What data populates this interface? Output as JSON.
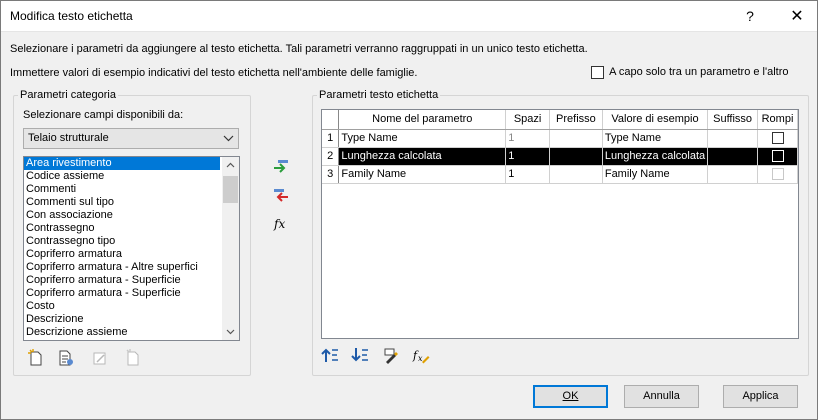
{
  "window": {
    "title": "Modifica testo etichetta",
    "help": "?",
    "close": "✕"
  },
  "intro": {
    "line1": "Selezionare i parametri da aggiungere al testo etichetta. Tali parametri verranno raggruppati in un unico testo etichetta.",
    "line2": "Immettere valori di esempio indicativi del testo etichetta nell'ambiente delle famiglie."
  },
  "wrap_checkbox": {
    "label": "A capo solo tra un parametro e l'altro",
    "checked": false
  },
  "category_group": {
    "label": "Parametri categoria",
    "select_label": "Selezionare campi disponibili da:",
    "combo_value": "Telaio strutturale",
    "items": [
      "Area rivestimento",
      "Codice assieme",
      "Commenti",
      "Commenti sul tipo",
      "Con associazione",
      "Contrassegno",
      "Contrassegno tipo",
      "Copriferro armatura",
      "Copriferro armatura - Altre superfici",
      "Copriferro armatura - Superficie inferiore",
      "Copriferro armatura - Superficie superiore",
      "Costo",
      "Descrizione",
      "Descrizione assieme"
    ],
    "selected_index": 0
  },
  "label_group": {
    "label": "Parametri testo etichetta",
    "columns": [
      "Nome del parametro",
      "Spazi",
      "Prefisso",
      "Valore di esempio",
      "Suffisso",
      "Rompi"
    ],
    "rows": [
      {
        "num": "1",
        "name": "Type Name",
        "spaces": "1",
        "prefix": "",
        "sample": "Type Name",
        "suffix": "",
        "break": false,
        "state": "normal"
      },
      {
        "num": "2",
        "name": "Lunghezza calcolata",
        "spaces": "1",
        "prefix": "",
        "sample": "Lunghezza calcolata",
        "suffix": "",
        "break": false,
        "state": "selected"
      },
      {
        "num": "3",
        "name": "Family Name",
        "spaces": "1",
        "prefix": "",
        "sample": "Family Name",
        "suffix": "",
        "break": false,
        "state": "disabled"
      }
    ]
  },
  "buttons": {
    "ok": "OK",
    "cancel": "Annulla",
    "apply": "Applica"
  },
  "icons": {
    "add": "add-parameter-icon",
    "remove": "remove-parameter-icon",
    "fx": "fx",
    "fx_icon": "formula-icon"
  },
  "colors": {
    "selection": "#0078d7",
    "add_arrow": "#2a9d3c",
    "remove_arrow": "#d42a2a",
    "move_arrow": "#1e5aa8"
  }
}
